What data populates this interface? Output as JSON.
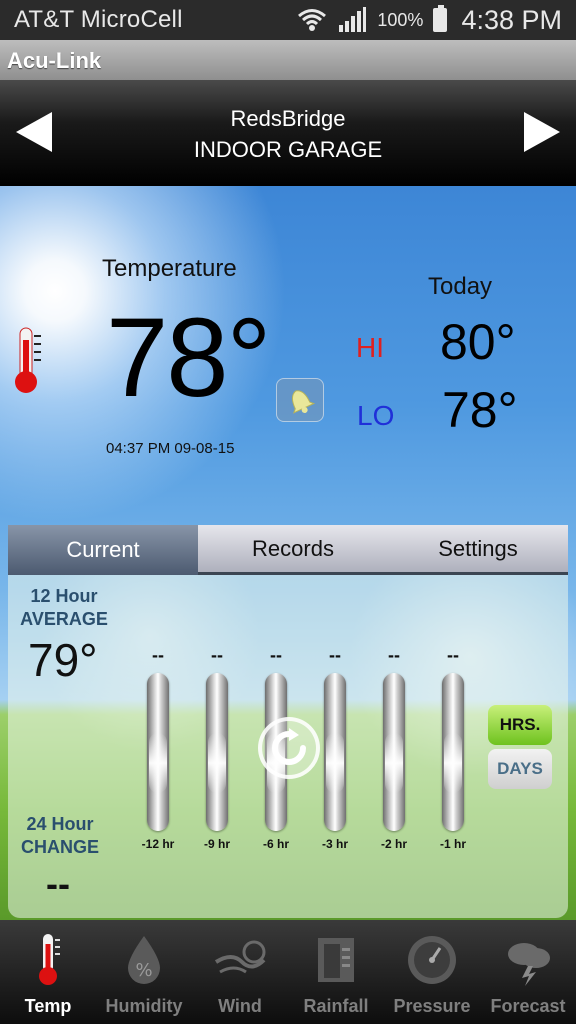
{
  "status_bar": {
    "carrier": "AT&T MicroCell",
    "battery_percent": "100%",
    "time": "4:38 PM"
  },
  "app": {
    "title": "Acu-Link"
  },
  "location": {
    "name": "RedsBridge",
    "sensor": "INDOOR GARAGE"
  },
  "current": {
    "label": "Temperature",
    "value": "78°",
    "timestamp": "04:37 PM 09-08-15"
  },
  "today": {
    "label": "Today",
    "hi_label": "HI",
    "hi_value": "80°",
    "lo_label": "LO",
    "lo_value": "78°"
  },
  "tabs": [
    {
      "label": "Current",
      "active": true
    },
    {
      "label": "Records",
      "active": false
    },
    {
      "label": "Settings",
      "active": false
    }
  ],
  "average": {
    "title_line1": "12 Hour",
    "title_line2": "AVERAGE",
    "value": "79°"
  },
  "change": {
    "title_line1": "24 Hour",
    "title_line2": "CHANGE",
    "value": "--"
  },
  "history_bars": [
    {
      "label": "-12 hr",
      "value": "--"
    },
    {
      "label": "-9 hr",
      "value": "--"
    },
    {
      "label": "-6 hr",
      "value": "--"
    },
    {
      "label": "-3 hr",
      "value": "--"
    },
    {
      "label": "-2 hr",
      "value": "--"
    },
    {
      "label": "-1 hr",
      "value": "--"
    }
  ],
  "toggle": {
    "hours_label": "HRS.",
    "days_label": "DAYS",
    "selected": "HRS."
  },
  "bottom_nav": [
    {
      "label": "Temp",
      "icon": "thermometer-icon",
      "active": true
    },
    {
      "label": "Humidity",
      "icon": "humidity-drop-icon",
      "active": false
    },
    {
      "label": "Wind",
      "icon": "wind-icon",
      "active": false
    },
    {
      "label": "Rainfall",
      "icon": "rain-gauge-icon",
      "active": false
    },
    {
      "label": "Pressure",
      "icon": "pressure-gauge-icon",
      "active": false
    },
    {
      "label": "Forecast",
      "icon": "storm-cloud-icon",
      "active": false
    }
  ],
  "colors": {
    "hi": "#e02020",
    "lo": "#2030d8",
    "accent_green": "#6ec21e",
    "label_blue": "#2a4f6e"
  }
}
